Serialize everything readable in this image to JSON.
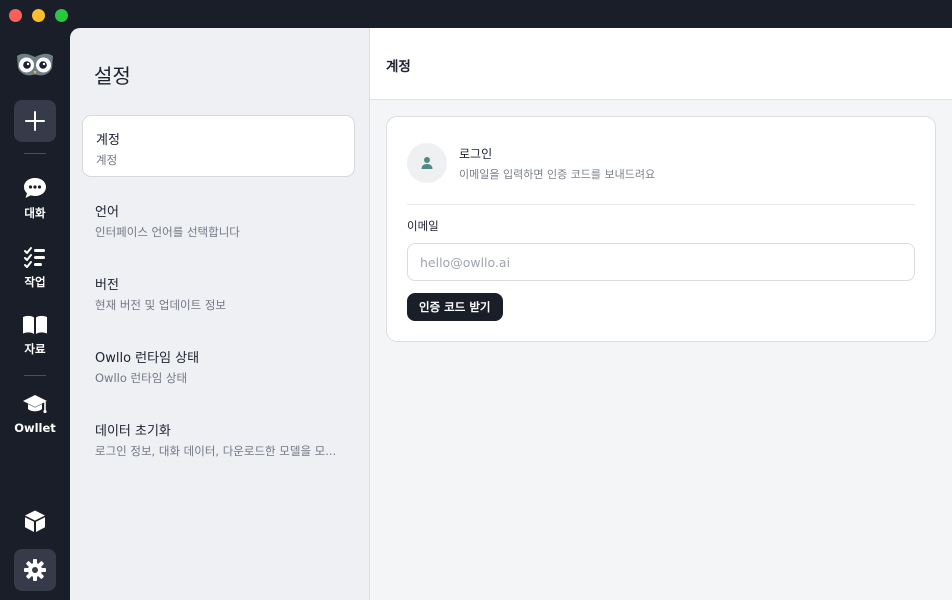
{
  "rail": {
    "items": [
      {
        "label": "대화",
        "icon": "chat-icon"
      },
      {
        "label": "작업",
        "icon": "task-list-icon"
      },
      {
        "label": "자료",
        "icon": "book-icon"
      },
      {
        "label": "Owllet",
        "icon": "graduation-cap-icon"
      }
    ]
  },
  "settings": {
    "title": "설정",
    "items": [
      {
        "title": "계정",
        "subtitle": "계정"
      },
      {
        "title": "언어",
        "subtitle": "인터페이스 언어를 선택합니다"
      },
      {
        "title": "버전",
        "subtitle": "현재 버전 및 업데이트 정보"
      },
      {
        "title": "Owllo 런타임 상태",
        "subtitle": "Owllo 런타임 상태"
      },
      {
        "title": "데이터 초기화",
        "subtitle": "로그인 정보, 대화 데이터, 다운로드한 모델을 모..."
      }
    ]
  },
  "main": {
    "header_title": "계정",
    "login": {
      "title": "로그인",
      "description": "이메일을 입력하면 인증 코드를 보내드려요",
      "email_label": "이메일",
      "email_placeholder": "hello@owllo.ai",
      "email_value": "",
      "submit_label": "인증 코드 받기"
    }
  },
  "colors": {
    "rail_bg": "#1a1e29",
    "panel_bg": "#eff0f3",
    "accent_dark": "#1a1e29",
    "avatar_icon": "#4f8a84"
  }
}
